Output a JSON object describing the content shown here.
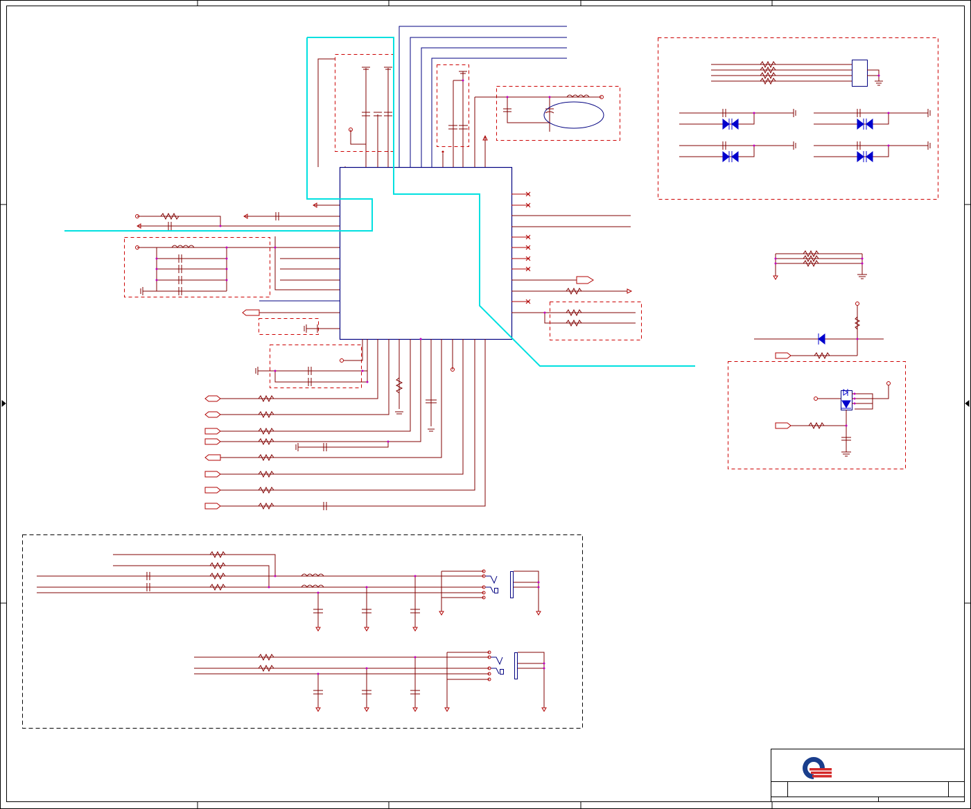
{
  "sheet": {
    "background": "#ffffff",
    "colors": {
      "border": "#000000",
      "wire": "#800000",
      "bus": "#000080",
      "component": "#b00000",
      "junction": "#c000c0",
      "diode": "#0000cc",
      "group_box": "#cc0000",
      "section_box": "#000000",
      "annotation": "#00e0e0",
      "logo_blue": "#1a3e8c",
      "logo_red": "#d42a2a"
    },
    "icons": [
      "company-logo-icon",
      "resistor-icon",
      "capacitor-icon",
      "inductor-icon",
      "diode-icon",
      "ground-icon",
      "power-arrow-icon",
      "port-tag-icon",
      "no-connect-icon",
      "crystal-icon",
      "audio-jack-icon"
    ]
  }
}
